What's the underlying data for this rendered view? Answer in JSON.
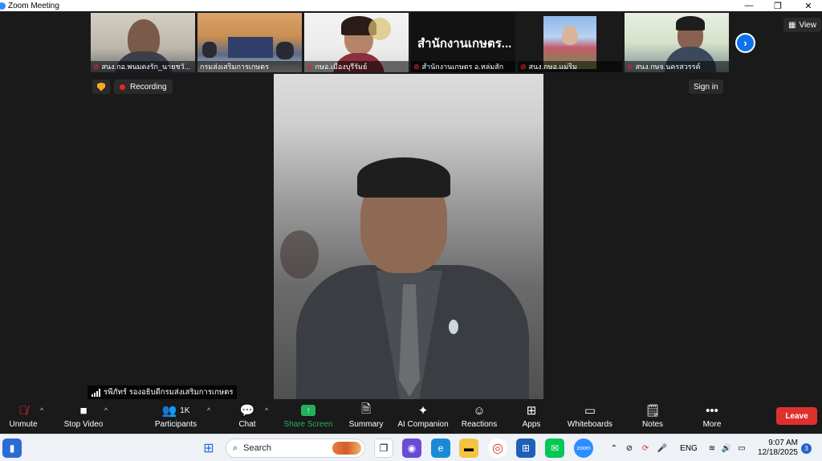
{
  "window": {
    "title": "Zoom Meeting",
    "minimize_glyph": "—",
    "restore_glyph": "❐",
    "close_glyph": "✕"
  },
  "gallery": {
    "thumbnails": [
      {
        "name": "สนง.กอ.พนมดงรัก_นายชวั...",
        "muted": true
      },
      {
        "name": "กรมส่งเสริมการเกษตร",
        "muted": false
      },
      {
        "name": "กษอ.เมืองบุรีรัมย์",
        "muted": true
      },
      {
        "name": "สำนักงานเกษตร อ.หล่มสัก",
        "muted": true,
        "display_text": "สำนักงานเกษตร..."
      },
      {
        "name": "สนง.กษอ.แม่ริม",
        "muted": true
      },
      {
        "name": "สนง.กษจ.นครสวรรค์",
        "muted": true
      }
    ],
    "next_glyph": "›",
    "view_label": "View"
  },
  "status": {
    "recording_label": "Recording",
    "signin_label": "Sign in"
  },
  "active_speaker": {
    "name": "รพีภัทร์ รองอธิบดีกรมส่งเสริมการเกษตร"
  },
  "controls": {
    "unmute": "Unmute",
    "stop_video": "Stop Video",
    "participants": "Participants",
    "participants_count": "1K",
    "chat": "Chat",
    "share_screen": "Share Screen",
    "summary": "Summary",
    "ai_companion": "AI Companion",
    "reactions": "Reactions",
    "apps": "Apps",
    "whiteboards": "Whiteboards",
    "notes": "Notes",
    "more": "More",
    "leave": "Leave",
    "caret_glyph": "^"
  },
  "taskbar": {
    "search_placeholder": "Search",
    "language": "ENG",
    "time": "9:07 AM",
    "date": "12/18/2025",
    "notification_count": "3"
  },
  "colors": {
    "zoom_blue": "#0e72ed",
    "share_green": "#21b35a",
    "leave_red": "#e0302e",
    "recording_red": "#e02828"
  }
}
